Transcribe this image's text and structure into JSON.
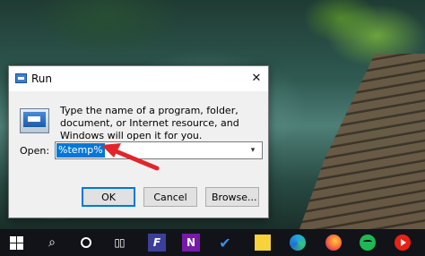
{
  "dialog": {
    "title": "Run",
    "description": "Type the name of a program, folder, document, or Internet resource, and Windows will open it for you.",
    "open_label": "Open:",
    "open_value": "%temp%",
    "ok_label": "OK",
    "cancel_label": "Cancel",
    "browse_label": "Browse...",
    "close_glyph": "✕",
    "dropdown_glyph": "▾"
  },
  "annotation": {
    "arrow_color": "#e0262b"
  },
  "taskbar": {
    "items": [
      {
        "icon": "windows-start-icon"
      },
      {
        "icon": "search-icon",
        "glyph": "⌕"
      },
      {
        "icon": "cortana-icon"
      },
      {
        "icon": "task-view-icon",
        "glyph": "▯▯"
      },
      {
        "icon": "f-app-icon",
        "glyph": "F"
      },
      {
        "icon": "onenote-icon",
        "glyph": "N"
      },
      {
        "icon": "todo-icon",
        "glyph": "✔"
      },
      {
        "icon": "sticky-notes-icon"
      },
      {
        "icon": "edge-icon"
      },
      {
        "icon": "firefox-icon"
      },
      {
        "icon": "spotify-icon"
      },
      {
        "icon": "youtube-icon"
      }
    ]
  }
}
